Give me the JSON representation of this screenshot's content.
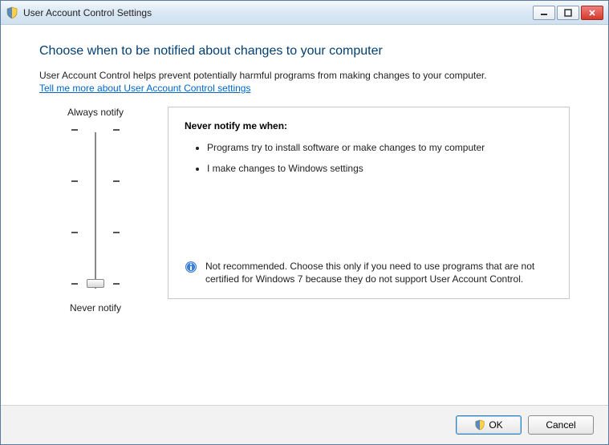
{
  "window": {
    "title": "User Account Control Settings"
  },
  "main": {
    "heading": "Choose when to be notified about changes to your computer",
    "description": "User Account Control helps prevent potentially harmful programs from making changes to your computer.",
    "helplink": "Tell me more about User Account Control settings"
  },
  "slider": {
    "top_label": "Always notify",
    "bottom_label": "Never notify",
    "levels": 4,
    "current_level": 0
  },
  "panel": {
    "title": "Never notify me when:",
    "items": [
      "Programs try to install software or make changes to my computer",
      "I make changes to Windows settings"
    ],
    "recommendation": "Not recommended. Choose this only if you need to use programs that are not certified for Windows 7 because they do not support User Account Control."
  },
  "footer": {
    "ok_label": "OK",
    "cancel_label": "Cancel"
  }
}
